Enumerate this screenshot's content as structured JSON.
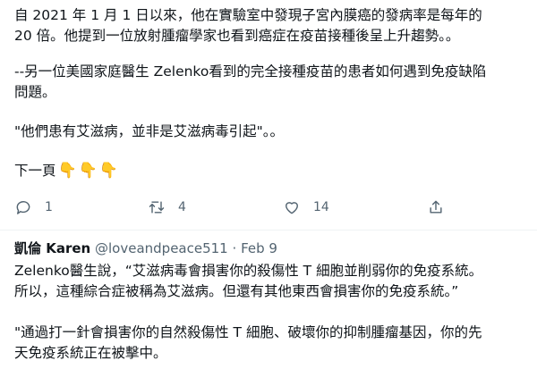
{
  "tweet": {
    "lines": [
      "自 2021 年 1 月 1 日以來，他在實驗室中發現子宮內膜癌的發病率是每年的",
      "20 倍。他提到一位放射腫瘤學家也看到癌症在疫苗接種後呈上升趨勢。。",
      "--另一位美國家庭醫生 Zelenko看到的完全接種疫苗的患者如何遇到免疫缺陷",
      "問題。",
      "\"他們患有艾滋病，並非是艾滋病毒引起\"。。",
      "下一頁"
    ],
    "emoji": "👇👇👇"
  },
  "actions": {
    "reply": {
      "icon": "comment-icon",
      "count": "1"
    },
    "retweet": {
      "icon": "retweet-icon",
      "count": "4"
    },
    "like": {
      "icon": "heart-icon",
      "count": "14"
    },
    "share": {
      "icon": "share-icon"
    }
  },
  "reply": {
    "name": "凱倫 Karen",
    "handle": "@loveandpeace511",
    "separator": "·",
    "date": "Feb 9",
    "lines": [
      "Zelenko醫生說，“艾滋病毒會損害你的殺傷性 T 細胞並削弱你的免疫系統。",
      "所以，這種綜合症被稱為艾滋病。但還有其他東西會損害你的免疫系統。”",
      "\"通過打一針會損害你的自然殺傷性 T 細胞、破壞你的抑制腫瘤基因，你的先",
      "天免疫系統正在被擊中。"
    ]
  }
}
